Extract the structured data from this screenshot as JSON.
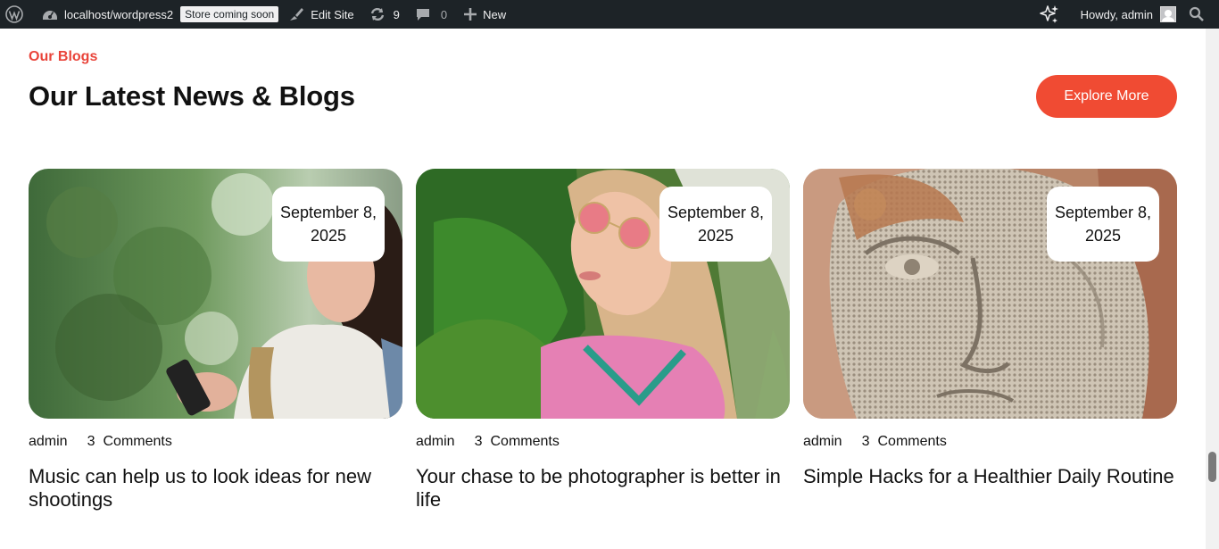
{
  "adminbar": {
    "site_url": "localhost/wordpress2",
    "store_badge": "Store coming soon",
    "edit_site": "Edit Site",
    "updates_count": "9",
    "comments_count": "0",
    "new_label": "New",
    "howdy": "Howdy, admin",
    "icons": [
      "wordpress-logo-icon",
      "dashboard-icon",
      "brush-icon",
      "refresh-icon",
      "comment-icon",
      "plus-icon",
      "sparkle-icon",
      "avatar",
      "search-icon"
    ]
  },
  "section": {
    "eyebrow": "Our Blogs",
    "heading": "Our Latest News & Blogs",
    "explore_button": "Explore More",
    "accent_color": "#f04b33"
  },
  "posts": [
    {
      "date_line1": "September 8,",
      "date_line2": "2025",
      "author": "admin",
      "comments_count": "3",
      "comments_label": "Comments",
      "title": "Music can help us to look ideas for new shootings"
    },
    {
      "date_line1": "September 8,",
      "date_line2": "2025",
      "author": "admin",
      "comments_count": "3",
      "comments_label": "Comments",
      "title": "Your chase to be photographer is better in life"
    },
    {
      "date_line1": "September 8,",
      "date_line2": "2025",
      "author": "admin",
      "comments_count": "3",
      "comments_label": "Comments",
      "title": "Simple Hacks for a Healthier Daily Routine"
    }
  ]
}
